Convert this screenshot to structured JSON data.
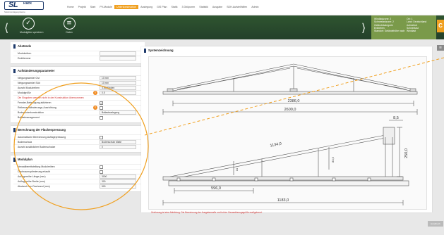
{
  "brand": {
    "logo_text": "SL",
    "logo_suffix": "Rack",
    "tagline": "Solarmontagesysteme"
  },
  "nav": {
    "items": [
      "Home",
      "Projekt",
      "Start",
      "PV-Module",
      "Unterkonstruktion",
      "Auslegung",
      "GIS Plan",
      "Statik",
      "3 Dbüporen",
      "Statistik",
      "Ausgabe",
      "SDH-Aufstellhilfen",
      "Admin"
    ],
    "active_index": 4
  },
  "toolbar": {
    "prev_icon": "chevron-left-icon",
    "next_icon": "chevron-right-icon",
    "buttons": [
      {
        "label": "Modulgitter speichern",
        "icon": "check-circle-icon"
      },
      {
        "label": "Daten",
        "icon": "database-icon"
      }
    ]
  },
  "infobox": {
    "col1": [
      "Windlastzone: 2",
      "Schneelastzone: 2",
      "Geländekategorie",
      "Erdbeben",
      "Standort: Geländehöhe nach"
    ],
    "col2": [
      "Ort: 1",
      "Land: Deutschland",
      "Aufstellort",
      "Schneelast",
      "Windlast"
    ],
    "tab_label": "C"
  },
  "sections": [
    {
      "title": "Abstände",
      "rows": [
        {
          "label": "Modulreihen",
          "type": "value",
          "value": ""
        },
        {
          "label": "Endklemme",
          "type": "value",
          "value": ""
        }
      ]
    },
    {
      "title": "Aufständerungsparameter",
      "rows": [
        {
          "label": "Neigungswinkel Ost",
          "type": "value",
          "value": "10 mm"
        },
        {
          "label": "Neigungswinkel Süd",
          "type": "value",
          "value": "10 mm"
        },
        {
          "label": "Anzahl Modulreihen",
          "type": "value",
          "value": "4 Abständen"
        },
        {
          "label": "Modulgröße",
          "type": "warn-value",
          "value": "0.5"
        },
        {
          "label": "Die Eingaben werden nicht in der Konstruktion übernommen",
          "type": "red"
        },
        {
          "label": "Fenster-Befestigung aktivieren",
          "type": "check",
          "checked": true
        },
        {
          "label": "Reihenaufständerungs-Ausrichtung",
          "type": "warn-check",
          "checked": false
        },
        {
          "label": "Bodenunterkonstruktion",
          "type": "value",
          "value": "Ballastauslegung"
        },
        {
          "label": "Ballastmanagement",
          "type": "check",
          "checked": false
        }
      ]
    },
    {
      "title": "Berechnung der Flächenpressung",
      "rows": [
        {
          "label": "Automatische Berechnung Auflagepressung",
          "type": "check",
          "checked": false
        },
        {
          "label": "Bodenschutz",
          "type": "value",
          "value": "Bodenschutz Matte"
        },
        {
          "label": "Anzahl zusätzlicher Bodenschutze",
          "type": "value",
          "value": "0"
        }
      ]
    },
    {
      "title": "Modulplan",
      "rows": [
        {
          "label": "Verwaltbereitstellung Modulreihen",
          "type": "check",
          "checked": false
        },
        {
          "label": "Dachraumoptimierung erlaubt",
          "type": "check",
          "checked": false
        },
        {
          "label": "Auflagereihe Länge (mm)",
          "type": "value",
          "value": "3000"
        },
        {
          "label": "Auflagereihe Breite (mm)",
          "type": "value",
          "value": "300"
        },
        {
          "label": "Abstand zum Dachrand (mm)",
          "type": "value",
          "value": "500"
        }
      ]
    }
  ],
  "drawing": {
    "title": "Systemzeichnung",
    "dim_top_inner": "2386,0",
    "dim_top_outer": "2600,0",
    "dim_slope": "1134,0",
    "dim_front": "8,5",
    "dim_height_right": "250,0",
    "dim_height_mid": "83,5",
    "dim_height_left": "10",
    "dim_bottom_inner": "596,0",
    "dim_bottom_outer": "1183,0",
    "note": "Zeichnung ist eine Abbildung. Die Berechnung der Ausgabemaße und ist der Gesamtbezugsgröße maßgebend."
  },
  "bottom_tab": "Handbuch",
  "colors": {
    "accent": "#f0a020",
    "toolbar_green": "#2f5530",
    "info_green": "#7a9a4a",
    "highlight": "#f0a020",
    "warning_red": "#d03030"
  }
}
